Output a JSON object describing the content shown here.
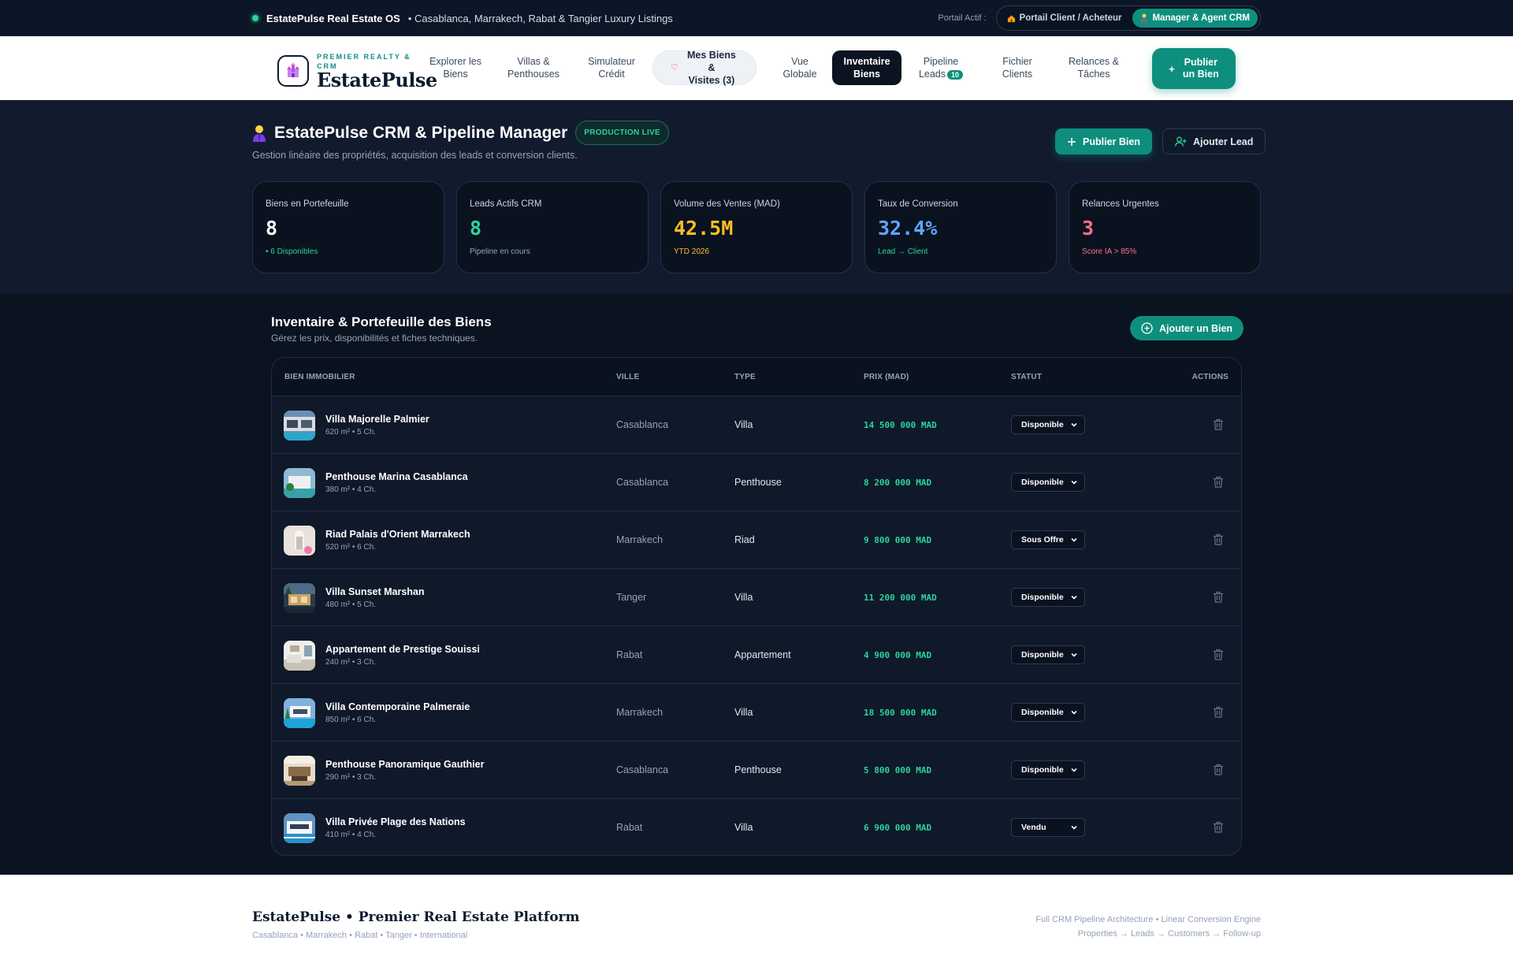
{
  "topbar": {
    "brand": "EstatePulse Real Estate OS",
    "cities": "• Casablanca, Marrakech, Rabat & Tangier Luxury Listings",
    "portal_label": "Portail Actif :",
    "portal_client": "Portail Client / Acheteur",
    "portal_agent": "Manager & Agent CRM"
  },
  "logo": {
    "tag_line1": "PREMIER REALTY &",
    "tag_line2": "CRM",
    "name": "EstatePulse"
  },
  "nav": {
    "explore_1": "Explorer les",
    "explore_2": "Biens",
    "villas_1": "Villas &",
    "villas_2": "Penthouses",
    "sim_1": "Simulateur",
    "sim_2": "Crédit",
    "fav_1": "Mes Biens &",
    "fav_2": "Visites (3)",
    "overview_1": "Vue",
    "overview_2": "Globale",
    "inventory_1": "Inventaire",
    "inventory_2": "Biens",
    "pipeline_1": "Pipeline",
    "pipeline_2": "Leads",
    "pipeline_badge": "10",
    "clients_1": "Fichier",
    "clients_2": "Clients",
    "followup_1": "Relances &",
    "followup_2": "Tâches",
    "cta_1": "Publier",
    "cta_2": "un Bien"
  },
  "header": {
    "title": "EstatePulse CRM & Pipeline Manager",
    "badge": "PRODUCTION LIVE",
    "subtitle": "Gestion linéaire des propriétés, acquisition des leads et conversion clients.",
    "btn_publish": "Publier Bien",
    "btn_lead": "Ajouter Lead"
  },
  "stats": [
    {
      "label": "Biens en Portefeuille",
      "value": "8",
      "sub": "• 6 Disponibles",
      "color": "#ffffff",
      "sub_color": "#2bd39a"
    },
    {
      "label": "Leads Actifs CRM",
      "value": "8",
      "sub": "Pipeline en cours",
      "color": "#2bd39a",
      "sub_color": "#94a3b8"
    },
    {
      "label": "Volume des Ventes (MAD)",
      "value": "42.5M",
      "sub": "YTD 2026",
      "color": "#fbbf24",
      "sub_color": "#fbbf24"
    },
    {
      "label": "Taux de Conversion",
      "value": "32.4%",
      "sub": "Lead → Client",
      "color": "#60a5fa",
      "sub_color": "#2bd39a"
    },
    {
      "label": "Relances Urgentes",
      "value": "3",
      "sub": "Score IA > 85%",
      "color": "#fb7185",
      "sub_color": "#fb7185"
    }
  ],
  "inventory": {
    "title": "Inventaire & Portefeuille des Biens",
    "subtitle": "Gérez les prix, disponibilités et fiches techniques.",
    "add_label": "Ajouter un Bien",
    "columns": {
      "property": "BIEN IMMOBILIER",
      "city": "VILLE",
      "type": "TYPE",
      "price": "PRIX (MAD)",
      "status": "STATUT",
      "actions": "ACTIONS"
    },
    "rows": [
      {
        "name": "Villa Majorelle Palmier",
        "meta": "620 m² • 5 Ch.",
        "city": "Casablanca",
        "type": "Villa",
        "price": "14 500 000 MAD",
        "status": "Disponible"
      },
      {
        "name": "Penthouse Marina Casablanca",
        "meta": "380 m² • 4 Ch.",
        "city": "Casablanca",
        "type": "Penthouse",
        "price": "8 200 000 MAD",
        "status": "Disponible"
      },
      {
        "name": "Riad Palais d'Orient Marrakech",
        "meta": "520 m² • 6 Ch.",
        "city": "Marrakech",
        "type": "Riad",
        "price": "9 800 000 MAD",
        "status": "Sous Offre"
      },
      {
        "name": "Villa Sunset Marshan",
        "meta": "480 m² • 5 Ch.",
        "city": "Tanger",
        "type": "Villa",
        "price": "11 200 000 MAD",
        "status": "Disponible"
      },
      {
        "name": "Appartement de Prestige Souissi",
        "meta": "240 m² • 3 Ch.",
        "city": "Rabat",
        "type": "Appartement",
        "price": "4 900 000 MAD",
        "status": "Disponible"
      },
      {
        "name": "Villa Contemporaine Palmeraie",
        "meta": "850 m² • 6 Ch.",
        "city": "Marrakech",
        "type": "Villa",
        "price": "18 500 000 MAD",
        "status": "Disponible"
      },
      {
        "name": "Penthouse Panoramique Gauthier",
        "meta": "290 m² • 3 Ch.",
        "city": "Casablanca",
        "type": "Penthouse",
        "price": "5 800 000 MAD",
        "status": "Disponible"
      },
      {
        "name": "Villa Privée Plage des Nations",
        "meta": "410 m² • 4 Ch.",
        "city": "Rabat",
        "type": "Villa",
        "price": "6 900 000 MAD",
        "status": "Vendu"
      }
    ]
  },
  "footer": {
    "brand": "EstatePulse • Premier Real Estate Platform",
    "cities": "Casablanca • Marrakech • Rabat • Tanger • International",
    "line1": "Full CRM Pipeline Architecture • Linear Conversion Engine",
    "line2": "Properties → Leads → Customers → Follow-up"
  },
  "colors": {
    "accent": "#0e8f7e",
    "price": "#2bd39a",
    "background": "#0b1220"
  }
}
